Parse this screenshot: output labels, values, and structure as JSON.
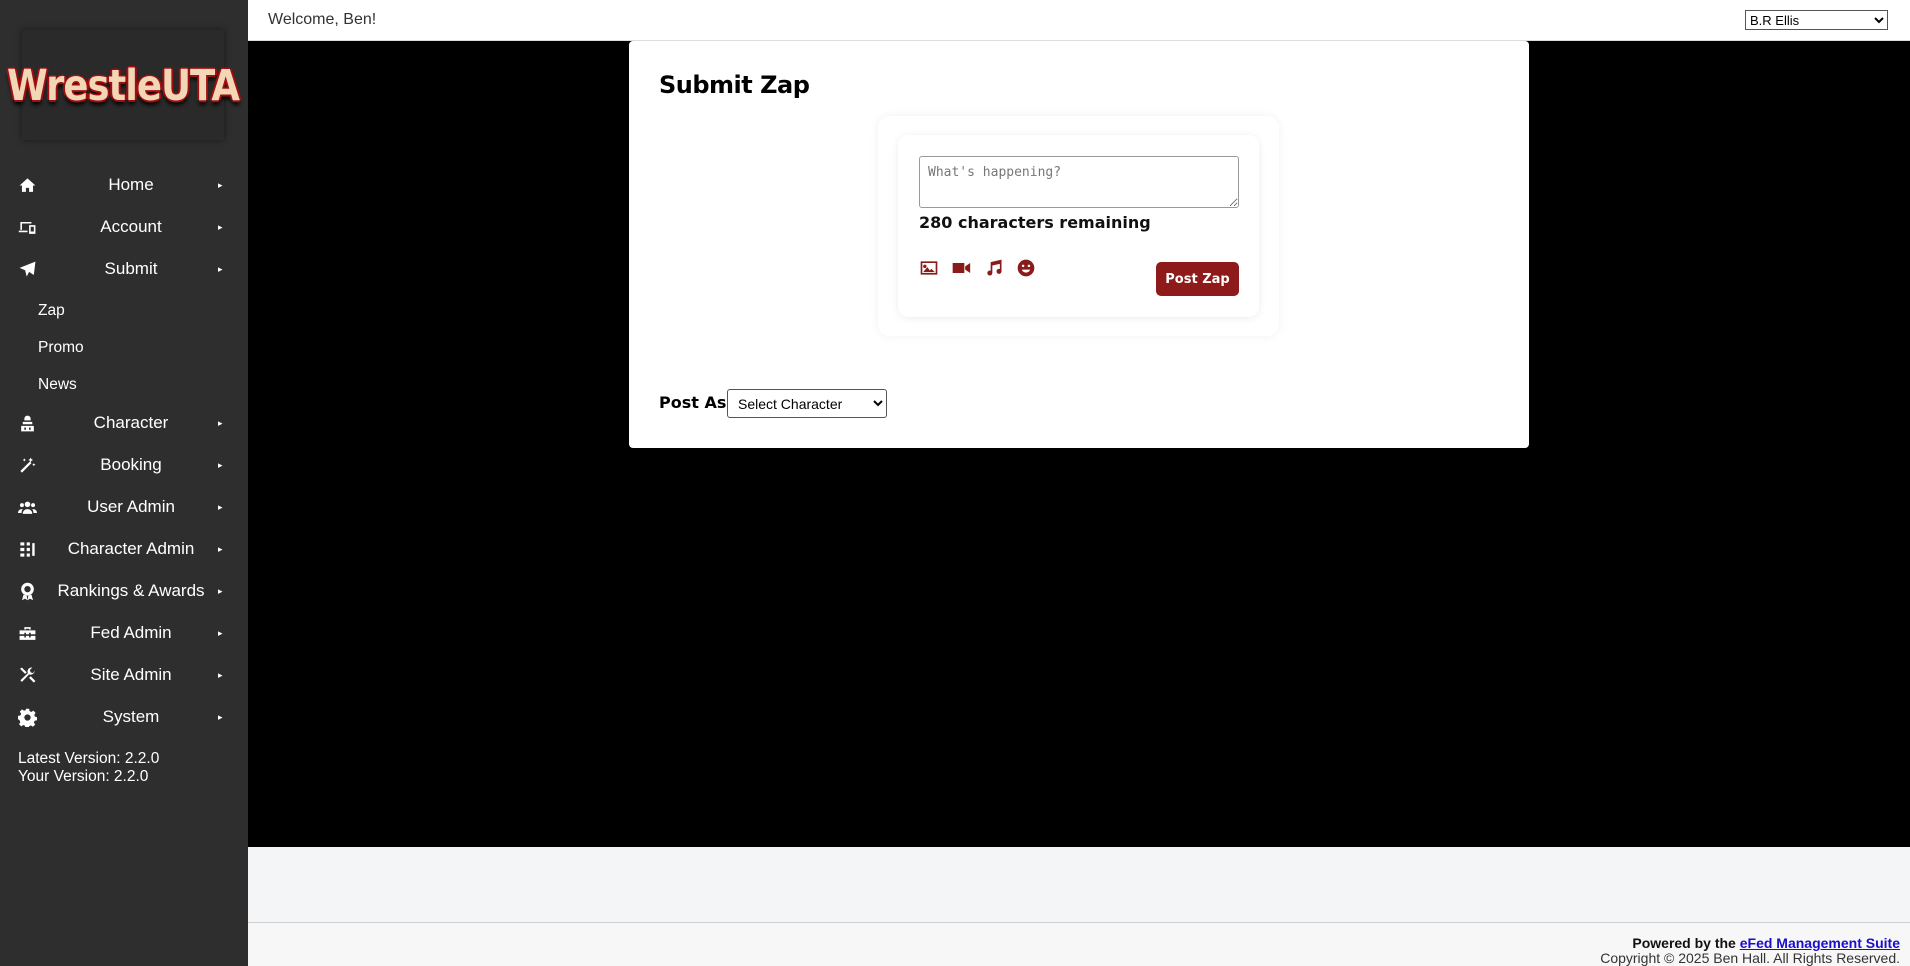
{
  "brand": {
    "logo_text": "WrestleUTA"
  },
  "sidebar": {
    "items": [
      {
        "label": "Home",
        "icon": "home-icon"
      },
      {
        "label": "Account",
        "icon": "devices-icon"
      },
      {
        "label": "Submit",
        "icon": "paper-plane-icon"
      },
      {
        "label": "Character",
        "icon": "character-icon"
      },
      {
        "label": "Booking",
        "icon": "magic-wand-icon"
      },
      {
        "label": "User Admin",
        "icon": "users-icon"
      },
      {
        "label": "Character Admin",
        "icon": "list-sort-icon"
      },
      {
        "label": "Rankings & Awards",
        "icon": "award-icon"
      },
      {
        "label": "Fed Admin",
        "icon": "toolbox-icon"
      },
      {
        "label": "Site Admin",
        "icon": "tools-icon"
      },
      {
        "label": "System",
        "icon": "gear-icon"
      }
    ],
    "submit_subitems": [
      "Zap",
      "Promo",
      "News"
    ],
    "arrow": "▸",
    "latest_version": "Latest Version: 2.2.0",
    "your_version": "Your Version: 2.2.0"
  },
  "topbar": {
    "welcome": "Welcome, Ben!",
    "character_selected": "B.R Ellis"
  },
  "main": {
    "title": "Submit Zap",
    "textarea_placeholder": "What's happening?",
    "remaining": "280 characters remaining",
    "media_icons": [
      "image-icon",
      "video-icon",
      "music-icon",
      "emoji-icon"
    ],
    "post_button": "Post Zap",
    "post_as_label": "Post As:",
    "post_as_selected": "Select Character"
  },
  "footer": {
    "powered_prefix": "Powered by the ",
    "powered_link": "eFed Management Suite",
    "copyright": "Copyright © 2025 Ben Hall. All Rights Reserved."
  },
  "colors": {
    "sidebar_bg": "#2e2e2e",
    "accent": "#8e1a1a",
    "main_bg": "#000000"
  }
}
